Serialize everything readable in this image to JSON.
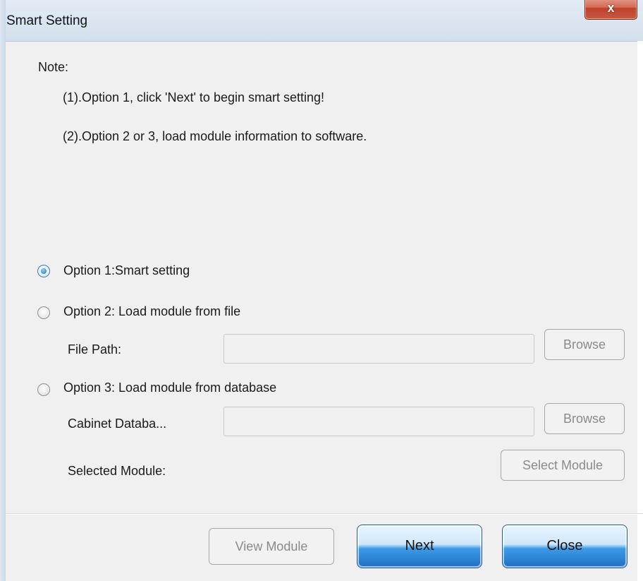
{
  "window": {
    "title": "Smart Setting",
    "close_glyph": "x"
  },
  "note": {
    "heading": "Note:",
    "line1": "(1).Option 1, click 'Next' to begin smart setting!",
    "line2": "(2).Option 2 or 3, load module information to software."
  },
  "options": {
    "option1": {
      "label": "Option 1:Smart setting",
      "selected": true
    },
    "option2": {
      "label": "Option 2: Load module from file",
      "selected": false
    },
    "option3": {
      "label": "Option 3: Load module from database",
      "selected": false
    }
  },
  "file_path": {
    "label": "File Path:",
    "value": "",
    "browse_label": "Browse"
  },
  "cabinet_database": {
    "label": "Cabinet Databa...",
    "value": "",
    "browse_label": "Browse"
  },
  "selected_module": {
    "label": "Selected Module:",
    "button_label": "Select Module"
  },
  "footer": {
    "view_module": "View Module",
    "next": "Next",
    "close": "Close"
  }
}
